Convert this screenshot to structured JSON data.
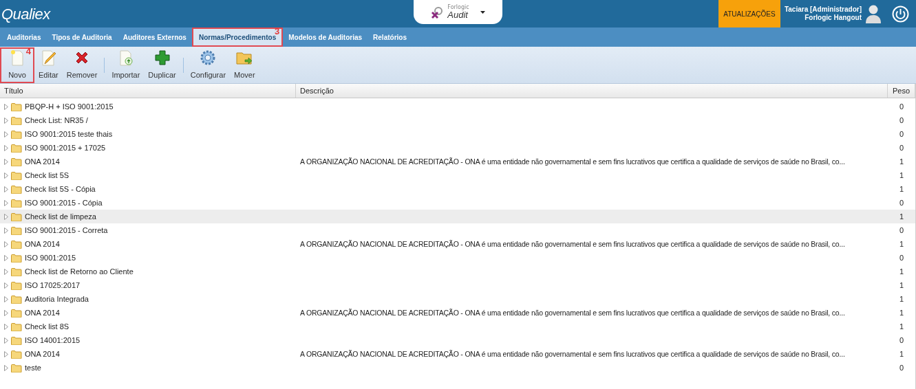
{
  "header": {
    "logo": "Qualiex",
    "product": {
      "brand": "Forlogic",
      "name": "Audit"
    },
    "updates_button": "ATUALIZAÇÕES",
    "user": {
      "name": "Taciara [Administrador]",
      "org": "Forlogic Hangout"
    }
  },
  "nav_tabs": [
    {
      "label": "Auditorias",
      "selected": false
    },
    {
      "label": "Tipos de Auditoria",
      "selected": false
    },
    {
      "label": "Auditores Externos",
      "selected": false
    },
    {
      "label": "Normas/Procedimentos",
      "selected": true,
      "callout": "3"
    },
    {
      "label": "Modelos de Auditorias",
      "selected": false
    },
    {
      "label": "Relatórios",
      "selected": false
    }
  ],
  "toolbar": [
    [
      {
        "kind": "new",
        "label": "Novo",
        "callout": "4"
      },
      {
        "kind": "edit",
        "label": "Editar"
      },
      {
        "kind": "remove",
        "label": "Remover"
      }
    ],
    [
      {
        "kind": "import",
        "label": "Importar"
      },
      {
        "kind": "duplicate",
        "label": "Duplicar"
      }
    ],
    [
      {
        "kind": "configure",
        "label": "Configurar"
      },
      {
        "kind": "move",
        "label": "Mover"
      }
    ]
  ],
  "table": {
    "columns": [
      "Título",
      "Descrição",
      "Peso"
    ],
    "rows": [
      {
        "title": "PBQP-H + ISO 9001:2015",
        "peso": "0",
        "selected": false
      },
      {
        "title": "Check List: NR35 /",
        "peso": "0",
        "selected": false
      },
      {
        "title": "ISO 9001:2015 teste thais",
        "peso": "0",
        "selected": false
      },
      {
        "title": "ISO 9001:2015 + 17025",
        "peso": "0",
        "selected": false
      },
      {
        "title": "ONA 2014",
        "description": "A ORGANIZAÇÃO NACIONAL DE ACREDITAÇÃO - ONA é uma entidade não governamental e sem fins lucrativos que certifica a qualidade de serviços de saúde no Brasil, co...",
        "peso": "1",
        "selected": false
      },
      {
        "title": "Check list 5S",
        "peso": "1",
        "selected": false
      },
      {
        "title": "Check list 5S - Cópia",
        "peso": "1",
        "selected": false
      },
      {
        "title": "ISO 9001:2015 - Cópia",
        "peso": "0",
        "selected": false
      },
      {
        "title": "Check list de limpeza",
        "peso": "1",
        "selected": true
      },
      {
        "title": "ISO 9001:2015 - Correta",
        "peso": "0",
        "selected": false
      },
      {
        "title": "ONA 2014",
        "description": "A ORGANIZAÇÃO NACIONAL DE ACREDITAÇÃO - ONA é uma entidade não governamental e sem fins lucrativos que certifica a qualidade de serviços de saúde no Brasil, co...",
        "peso": "1",
        "selected": false
      },
      {
        "title": "ISO 9001:2015",
        "peso": "0",
        "selected": false
      },
      {
        "title": "Check list de Retorno ao Cliente",
        "peso": "1",
        "selected": false
      },
      {
        "title": "ISO 17025:2017",
        "peso": "1",
        "selected": false
      },
      {
        "title": "Auditoria Integrada",
        "peso": "1",
        "selected": false
      },
      {
        "title": "ONA 2014",
        "description": "A ORGANIZAÇÃO NACIONAL DE ACREDITAÇÃO - ONA é uma entidade não governamental e sem fins lucrativos que certifica a qualidade de serviços de saúde no Brasil, co...",
        "peso": "1",
        "selected": false
      },
      {
        "title": "Check list 8S",
        "peso": "1",
        "selected": false
      },
      {
        "title": "ISO 14001:2015",
        "peso": "0",
        "selected": false
      },
      {
        "title": "ONA 2014",
        "description": "A ORGANIZAÇÃO NACIONAL DE ACREDITAÇÃO - ONA é uma entidade não governamental e sem fins lucrativos que certifica a qualidade de serviços de saúde no Brasil, co...",
        "peso": "1",
        "selected": false
      },
      {
        "title": "teste",
        "peso": "0",
        "selected": false
      }
    ]
  }
}
